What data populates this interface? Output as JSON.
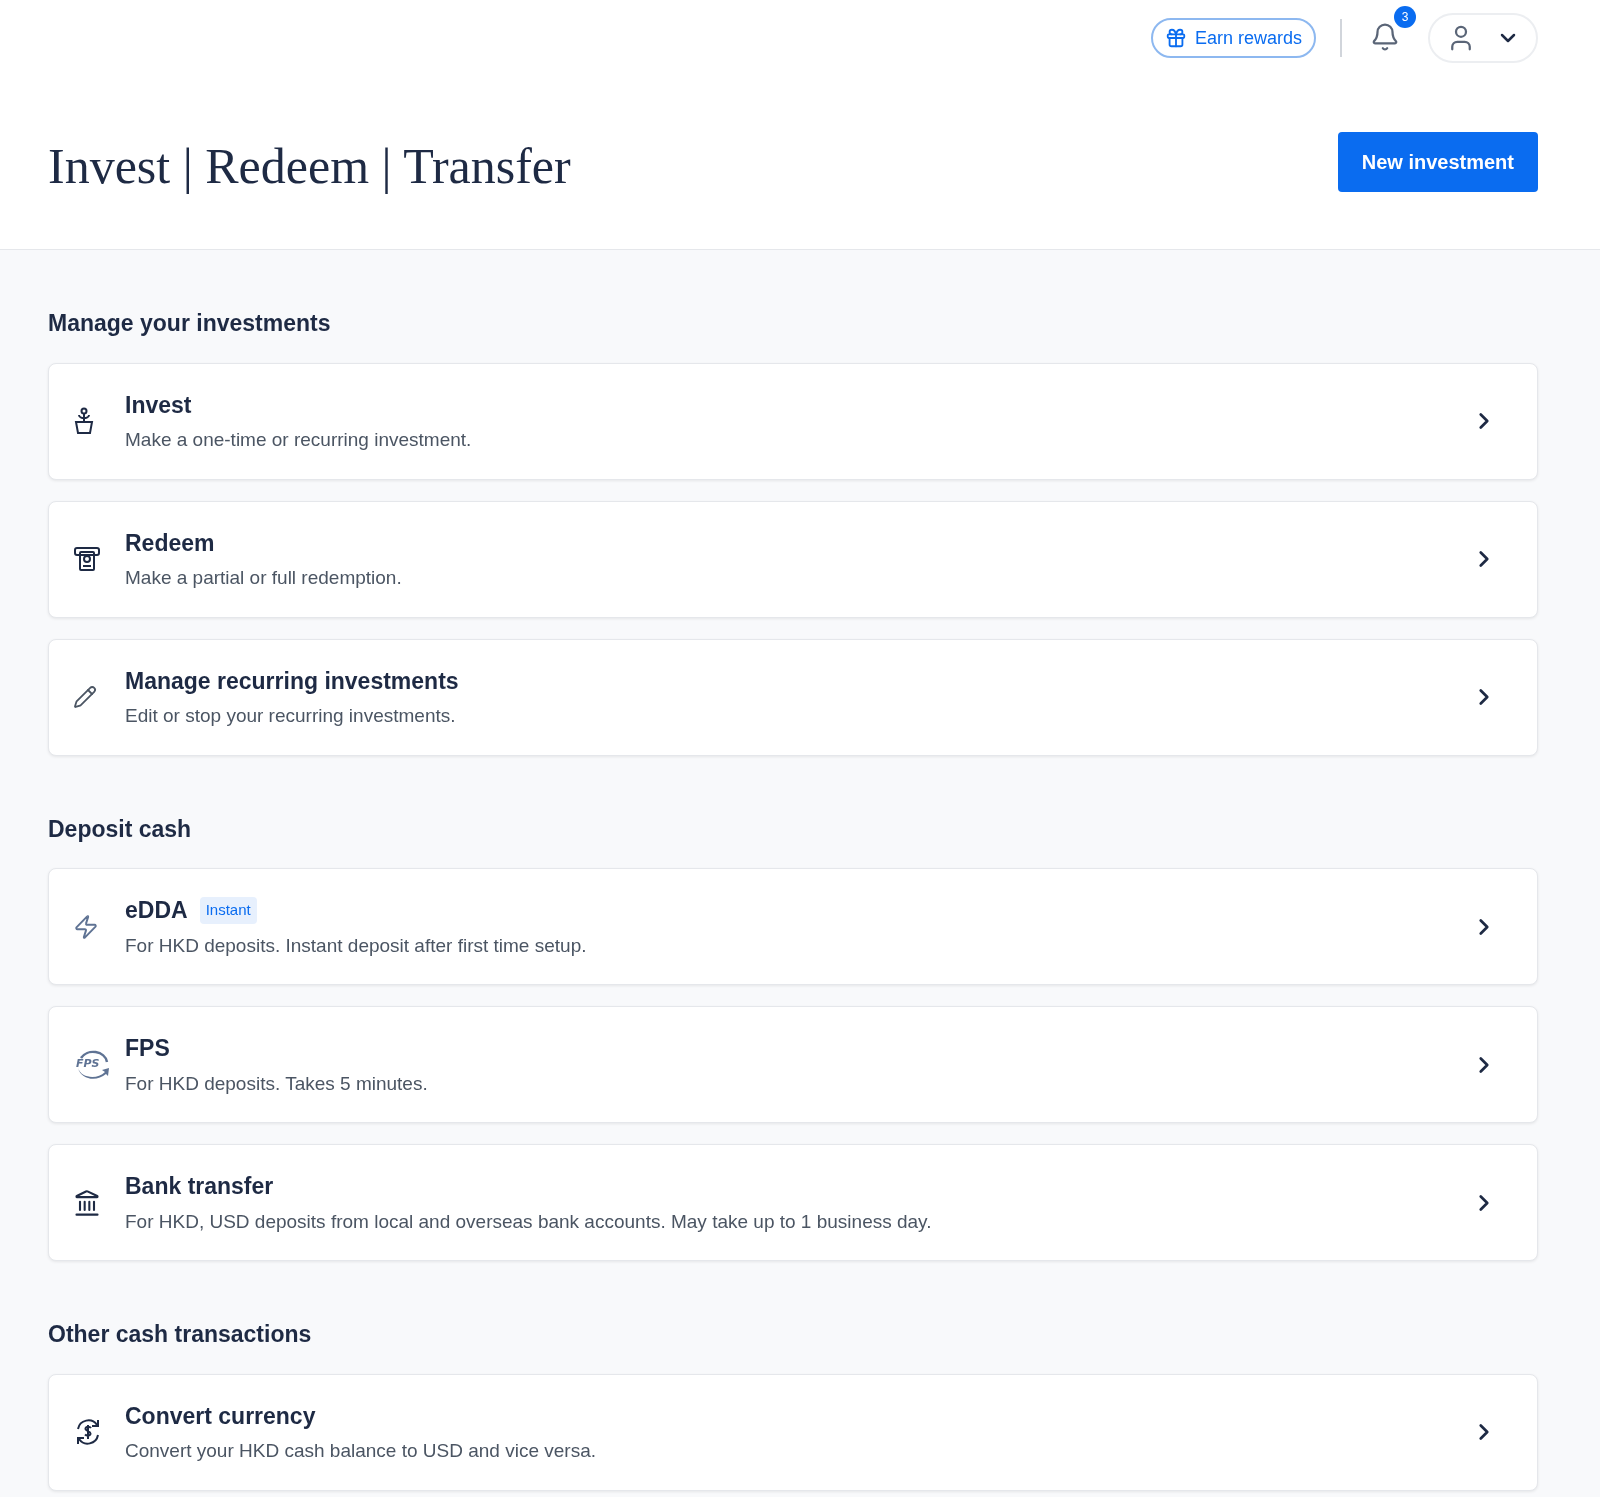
{
  "top_bar": {
    "rewards_button": "Earn rewards",
    "notification_count": "3"
  },
  "header": {
    "title": "Invest | Redeem | Transfer",
    "primary_button": "New investment"
  },
  "sections": [
    {
      "heading": "Manage your investments",
      "items": [
        {
          "title": "Invest",
          "description": "Make a one-time or recurring investment."
        },
        {
          "title": "Redeem",
          "description": "Make a partial or full redemption."
        },
        {
          "title": "Manage recurring investments",
          "description": "Edit or stop your recurring investments."
        }
      ]
    },
    {
      "heading": "Deposit cash",
      "items": [
        {
          "title": "eDDA",
          "badge": "Instant",
          "description": "For HKD deposits. Instant deposit after first time setup."
        },
        {
          "title": "FPS",
          "logo_text": "FPS",
          "description": "For HKD deposits. Takes 5 minutes."
        },
        {
          "title": "Bank transfer",
          "description": "For HKD, USD deposits from local and overseas bank accounts. May take up to 1 business day."
        }
      ]
    },
    {
      "heading": "Other cash transactions",
      "items": [
        {
          "title": "Convert currency",
          "description": "Convert your HKD cash balance to USD and vice versa."
        }
      ]
    }
  ]
}
